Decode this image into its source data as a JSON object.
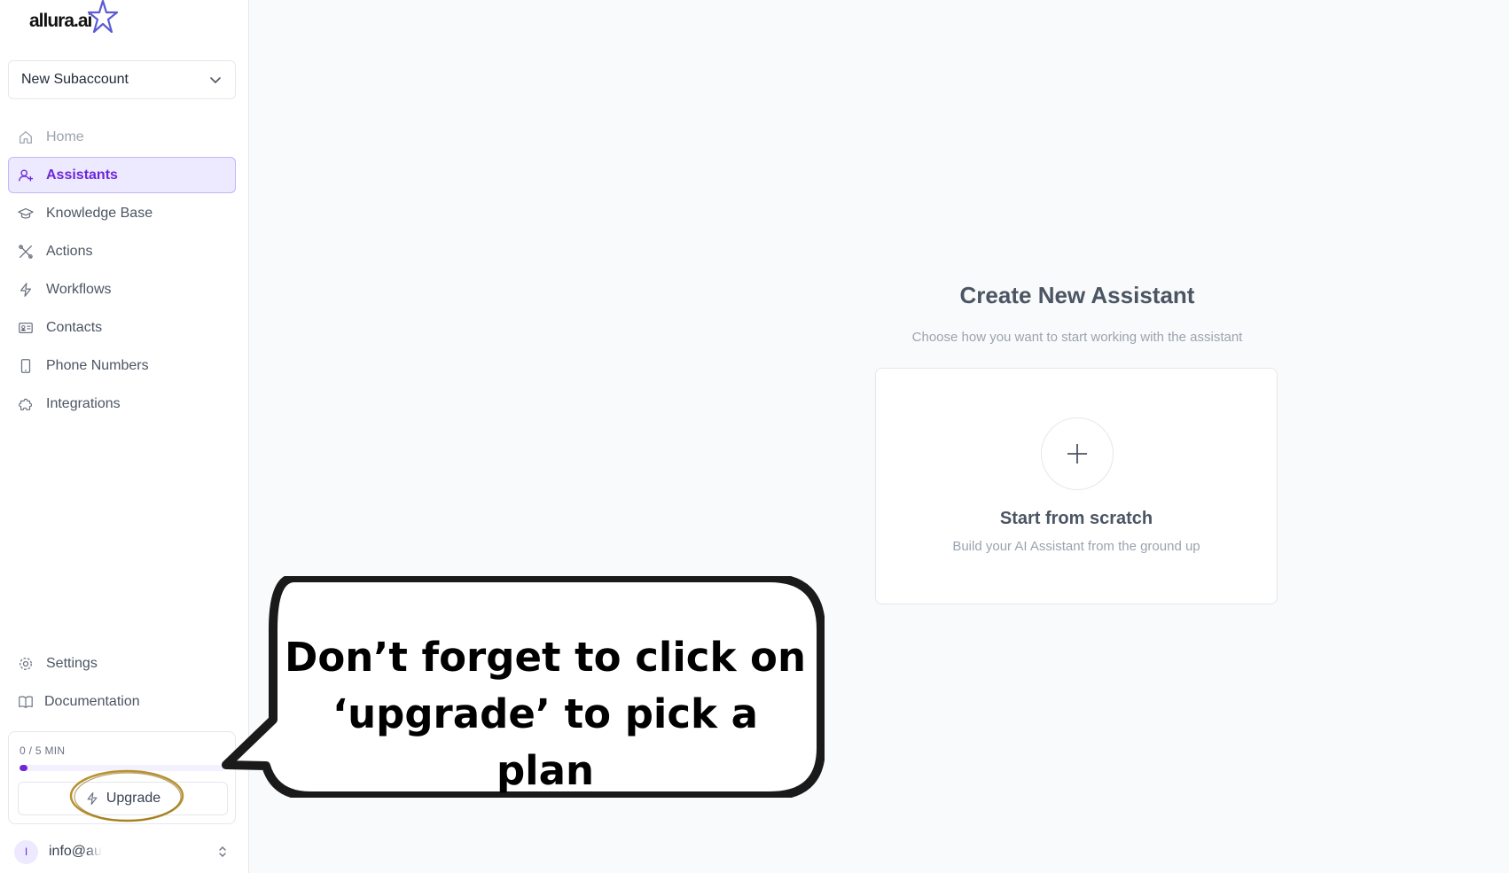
{
  "logo": {
    "text": "allura.ai"
  },
  "account": {
    "selected": "New Subaccount"
  },
  "nav": {
    "items": [
      {
        "label": "Home",
        "icon": "home-icon"
      },
      {
        "label": "Assistants",
        "icon": "user-plus-icon"
      },
      {
        "label": "Knowledge Base",
        "icon": "graduation-cap-icon"
      },
      {
        "label": "Actions",
        "icon": "tools-icon"
      },
      {
        "label": "Workflows",
        "icon": "bolt-icon"
      },
      {
        "label": "Contacts",
        "icon": "id-card-icon"
      },
      {
        "label": "Phone Numbers",
        "icon": "phone-icon"
      },
      {
        "label": "Integrations",
        "icon": "puzzle-icon"
      }
    ],
    "active": "Assistants"
  },
  "bottom_nav": {
    "settings": "Settings",
    "documentation": "Documentation"
  },
  "usage": {
    "label": "0 / 5 MIN",
    "used": 0,
    "total": 5,
    "upgrade_label": "Upgrade"
  },
  "user": {
    "initial": "I",
    "email": "info@au"
  },
  "main": {
    "title": "Create New Assistant",
    "subtitle": "Choose how you want to start working with the assistant",
    "card_title": "Start from scratch",
    "card_desc": "Build your AI Assistant from the ground up"
  },
  "callout": {
    "line1": "Don’t forget to click on",
    "line2": "‘upgrade’ to pick a plan"
  },
  "colors": {
    "accent": "#6d28d9",
    "accent_bg": "#ede9fe",
    "ring": "#b8922e"
  }
}
